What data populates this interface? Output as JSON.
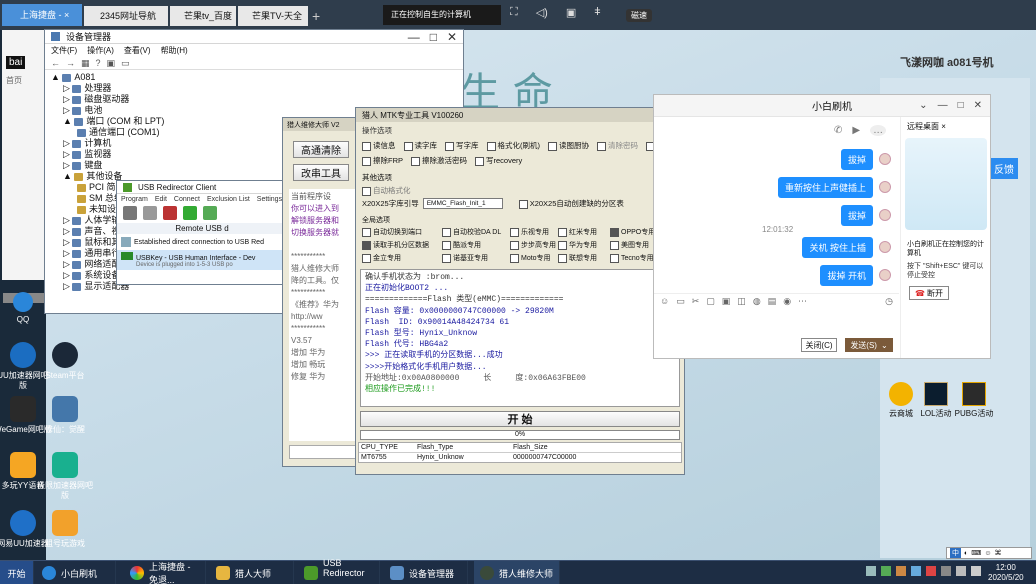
{
  "browser": {
    "tabs": [
      {
        "label": "上海捷盘 -"
      },
      {
        "label": "2345网址导航"
      },
      {
        "label": "芒果tv_百度搜索"
      },
      {
        "label": "芒果TV-天全看"
      }
    ],
    "new_tab": "+",
    "remote_notice": "正在控制自生的计算机",
    "win_badge": "磁速",
    "nav_left": "bai",
    "nav_left2": "首页"
  },
  "desktop_icons": [
    {
      "label": "QQ",
      "color": "#2a86d9"
    },
    {
      "label": "UU加速器网吧版",
      "color": "#1b6dc1"
    },
    {
      "label": "Steam平台",
      "color": "#1b2838"
    },
    {
      "label": "WeGame网吧版",
      "color": "#2a2a2a"
    },
    {
      "label": "修仙：觉醒",
      "color": "#4477aa"
    },
    {
      "label": "多玩YY语音",
      "color": "#f5a623"
    },
    {
      "label": "极限加速器网吧版",
      "color": "#19b08f"
    },
    {
      "label": "网易UU加速器",
      "color": "#1f70c8"
    },
    {
      "label": "租号玩游戏",
      "color": "#f2a12b"
    }
  ],
  "devmgr": {
    "title": "设备管理器",
    "menus": [
      "文件(F)",
      "操作(A)",
      "查看(V)",
      "帮助(H)"
    ],
    "tree": [
      "A081",
      "处理器",
      "磁盘驱动器",
      "电池",
      "端口 (COM 和 LPT)",
      "通信端口 (COM1)",
      "计算机",
      "监视器",
      "键盘",
      "其他设备",
      "PCI 简单",
      "SM 总线",
      "未知设备",
      "人体学输入",
      "声音、视频",
      "鼠标和其他",
      "通用串行总线",
      "网络适配器",
      "系统设备",
      "显示适配器"
    ]
  },
  "usb": {
    "title": "USB Redirector Client",
    "menus": [
      "Program",
      "Edit",
      "Connect",
      "Exclusion List",
      "Settings"
    ],
    "remote_label": "Remote USB d",
    "conn": "Established direct connection to USB Red",
    "device": "USBKey - USB Human Interface - Dev",
    "device_sub": "Device is plugged into 1-5-3 USB po"
  },
  "lieren": {
    "title": "猎人维修大师 V2",
    "btn1": "高通清除",
    "btn2": "改串工具",
    "lines": [
      "当前程序设",
      "你可以进入到",
      "解锁服务器和",
      "切换服务器就",
      "",
      "***********",
      "猎人维修大师",
      "降的工具。仅",
      "***********",
      "《推荐》华为",
      "http://ww",
      "***********",
      "V3.57",
      "增加 华为",
      "增加 畅玩",
      "修复 华为"
    ]
  },
  "mtk": {
    "title": "猎人 MTK专业工具 V100260",
    "sec_ops": "操作选项",
    "ops_row1": [
      "读信息",
      "读字库",
      "写字库",
      "格式化(刷机)",
      "读图厨协",
      "清除密码",
      "IMEI 修复"
    ],
    "ops_row2": [
      "擦除FRP",
      "擦除激活密码",
      "写recovery"
    ],
    "sec_other": "其他选项",
    "other_auto": "自动格式化",
    "x20_label": "X20X25字库引导",
    "x20_value": "EMMC_Flash_Init_1",
    "x20_auto": "X20X25自动创建缺的分区表",
    "sec_global": "全局选项",
    "global": [
      [
        "自动切换到端口",
        "自动校验DA DL",
        "乐视专用",
        "红米专用",
        "OPPO专用"
      ],
      [
        "读取手机分区数据",
        "酷派专用",
        "步步高专用",
        "华为专用",
        "美图专用"
      ],
      [
        "金立专用",
        "诺基亚专用",
        "Moto专用",
        "联想专用",
        "Tecno专用"
      ]
    ],
    "log": [
      {
        "t": "确认手机状态为 :brom...",
        "c": "#333"
      },
      {
        "t": "正在初始化BOOT2 ...",
        "c": "#1a1aa0"
      },
      {
        "t": "=============Flash 类型(eMMC)=============",
        "c": "#333"
      },
      {
        "t": "Flash 容量: 0x0000000747C00000 -> 29820M",
        "c": "#1a1aa0"
      },
      {
        "t": "Flash  ID: 0x90014A48424734 61",
        "c": "#1a1aa0"
      },
      {
        "t": "Flash 型号: Hynix_Unknow",
        "c": "#1a1aa0"
      },
      {
        "t": "Flash 代号: HBG4a2",
        "c": "#1a1aa0"
      },
      {
        "t": ">>> 正在读取手机的分区数据...成功",
        "c": "#1a1aa0"
      },
      {
        "t": ">>>>开始格式化手机用户数据...",
        "c": "#1a1aa0"
      },
      {
        "t": "开始地址:0x00A0800000     长     度:0x06A63FBE00",
        "c": "#555"
      },
      {
        "t": "相应操作已完成!!!",
        "c": "#1a9a1a"
      }
    ],
    "start": "开  始",
    "progress_text": "0%",
    "progress": 0,
    "table_headers": [
      "CPU_TYPE",
      "Flash_Type",
      "Flash_Size"
    ],
    "table_row": [
      "MT6755",
      "Hynix_Unknow",
      "0000000747C00000"
    ]
  },
  "chat": {
    "title": "小白刷机",
    "messages": [
      "拔掉",
      "重新按住上声健插上",
      "拔掉",
      "关机 按住上插",
      "拔掉 开机"
    ],
    "time": "12:01:32",
    "remote_title": "远程桌面",
    "remote_text": "小白刷机正在控制您的计算机",
    "remote_hint": "按下 \"Shift+ESC\" 键可以停止受控",
    "disconnect": "断开",
    "close_btn": "关闭(C)",
    "send_btn": "发送(S)"
  },
  "side": {
    "user": "飞漾网咖 a081号机",
    "feedback": "反馈",
    "apps": [
      "云商城",
      "LOL活动",
      "PUBG活动"
    ]
  },
  "taskbar": {
    "start": "开始",
    "items": [
      "小白刷机",
      "上海捷盘 - 免退...",
      "猎人大师",
      "USB Redirector ...",
      "设备管理器",
      "猎人维修大师"
    ],
    "time": "12:00",
    "date": "2020/5/20",
    "ime": "中"
  }
}
